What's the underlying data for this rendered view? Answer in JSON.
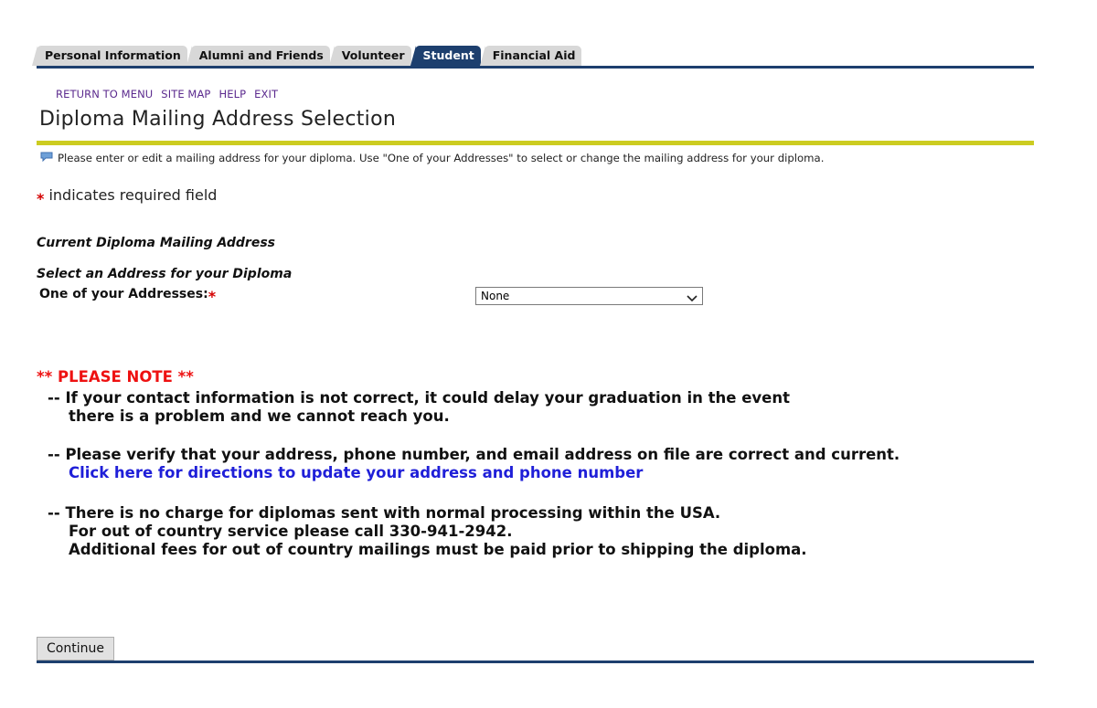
{
  "tabs": [
    {
      "label": "Personal Information",
      "active": false
    },
    {
      "label": "Alumni and Friends",
      "active": false
    },
    {
      "label": "Volunteer",
      "active": false
    },
    {
      "label": "Student",
      "active": true
    },
    {
      "label": "Financial Aid",
      "active": false
    }
  ],
  "nav": {
    "return_to_menu": "RETURN TO MENU",
    "site_map": "SITE MAP",
    "help": "HELP",
    "exit": "EXIT"
  },
  "page": {
    "title": "Diploma Mailing Address Selection",
    "info_icon": "comment-bubble-icon",
    "info_text": "Please enter or edit a mailing address for your diploma. Use \"One of your Addresses\" to select or change the mailing address for your diploma.",
    "required_star": "*",
    "required_text": "indicates required field"
  },
  "form": {
    "current_address_heading": "Current Diploma Mailing Address",
    "select_heading": "Select an Address for your Diploma",
    "field_label": "One of your Addresses:",
    "field_required_star": "*",
    "selected_value": "None"
  },
  "note": {
    "title": "** PLEASE NOTE **",
    "item1_line1": "-- If your contact information is not correct, it could delay your graduation in the event",
    "item1_line2": "there is a problem and we cannot reach you.",
    "item2_line1": "-- Please verify that your address, phone number, and email address on file are correct and current.",
    "item2_link": "Click here for directions to update your address and phone number",
    "item3_line1": "-- There is no charge for diplomas sent with normal processing within the USA.",
    "item3_line2": "For out of country service please call 330-941-2942.",
    "item3_line3": "Additional fees for out of country mailings must be paid prior to shipping the diploma."
  },
  "buttons": {
    "continue": "Continue"
  },
  "colors": {
    "tab_active": "#1d3f6e",
    "tab_inactive": "#d8d8d8",
    "title_rule": "#cccc21",
    "nav_link": "#5b2a8e",
    "note_title": "#ee1111",
    "link": "#1f1fd8",
    "required_star": "#d40000"
  }
}
